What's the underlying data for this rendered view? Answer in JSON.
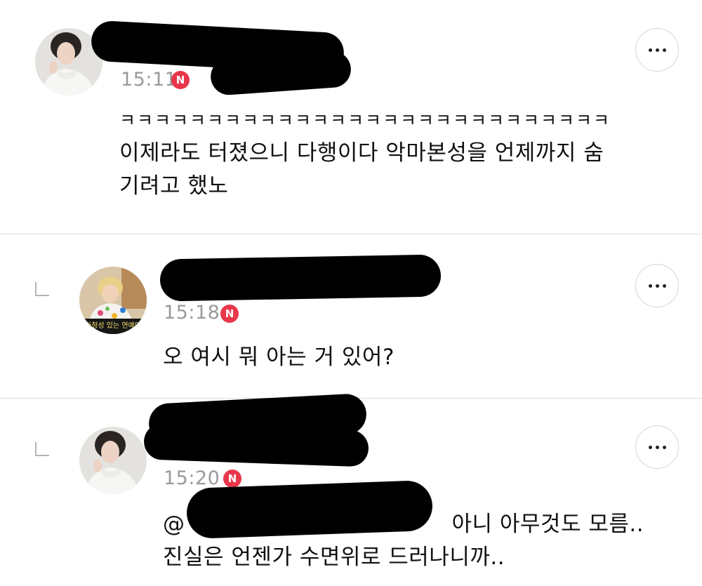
{
  "comments": [
    {
      "time": "15:11",
      "badge": "N",
      "lines": [
        "ㅋㅋㅋㅋㅋㅋㅋㅋㅋㅋㅋㅋㅋㅋㅋㅋㅋㅋㅋㅋㅋㅋㅋㅋㅋㅋㅋㅋ",
        "이제라도 터졌으니 다행이다 악마본성을 언제까지 숨",
        "기려고 했노"
      ],
      "more_icon": "ellipsis-icon"
    },
    {
      "time": "15:18",
      "badge": "N",
      "avatar_caption": "가정성 있는 연예인",
      "lines": [
        "오 여시 뭐 아는 거 있어?"
      ],
      "more_icon": "ellipsis-icon"
    },
    {
      "time": "15:20",
      "badge": "N",
      "mention_prefix": "@",
      "lines": [
        "아니 아무것도 모름..",
        "진실은 언젠가 수면위로 드러나니까.."
      ],
      "more_icon": "ellipsis-icon"
    }
  ],
  "colors": {
    "badge": "#e8374a",
    "timestamp": "#9a9a9a",
    "divider": "#dcdcdc",
    "redaction": "#000000"
  }
}
